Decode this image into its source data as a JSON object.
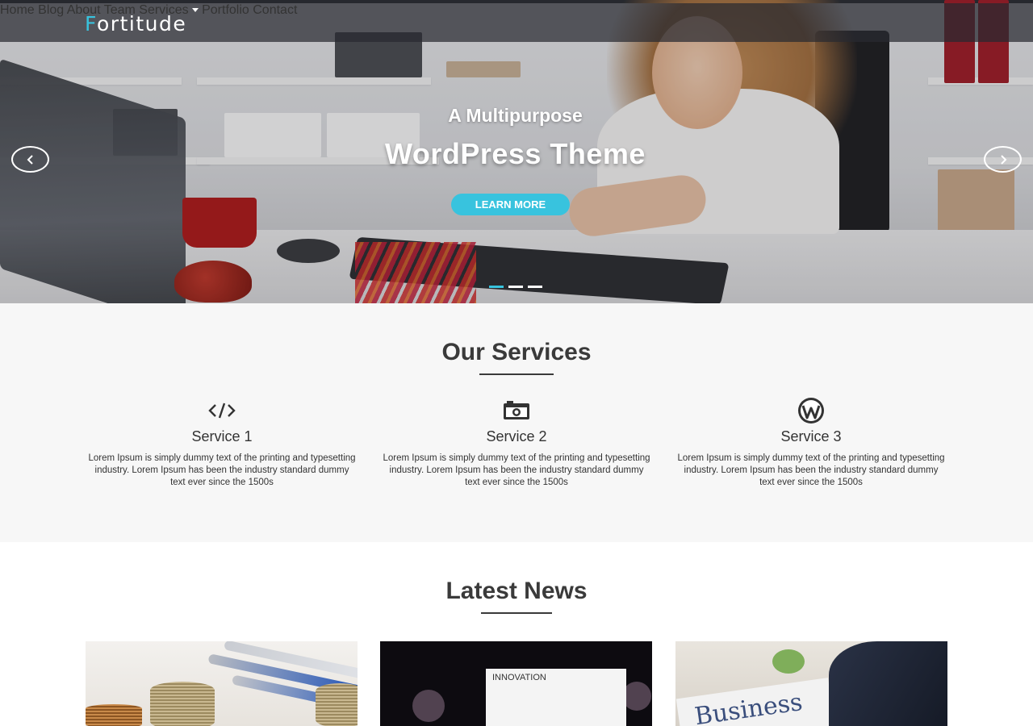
{
  "brand": {
    "logo_first": "F",
    "logo_rest": "ortitude",
    "accent": "#38c3de"
  },
  "nav": {
    "items": [
      {
        "label": "Home",
        "active": true
      },
      {
        "label": "Blog"
      },
      {
        "label": "About"
      },
      {
        "label": "Team"
      },
      {
        "label": "Services",
        "dropdown": true
      },
      {
        "label": "Portfolio"
      },
      {
        "label": "Contact"
      }
    ]
  },
  "hero": {
    "subtitle": "A Multipurpose",
    "title": "WordPress Theme",
    "button_label": "LEARN MORE",
    "prev_icon": "chevron-left-icon",
    "next_icon": "chevron-right-icon",
    "slides": 3,
    "active_slide": 1
  },
  "services": {
    "title": "Our Services",
    "items": [
      {
        "icon": "code-icon",
        "name": "Service 1",
        "desc": "Lorem Ipsum is simply dummy text of the printing and typesetting industry. Lorem Ipsum has been the industry standard dummy text ever since the 1500s"
      },
      {
        "icon": "camera-icon",
        "name": "Service 2",
        "desc": "Lorem Ipsum is simply dummy text of the printing and typesetting industry. Lorem Ipsum has been the industry standard dummy text ever since the 1500s"
      },
      {
        "icon": "wordpress-icon",
        "name": "Service 3",
        "desc": "Lorem Ipsum is simply dummy text of the printing and typesetting industry. Lorem Ipsum has been the industry standard dummy text ever since the 1500s"
      }
    ]
  },
  "news": {
    "title": "Latest News",
    "cards": [
      {
        "image": "coins-and-pens-image"
      },
      {
        "image": "innovation-board-image",
        "board_text": "INNOVATION"
      },
      {
        "image": "business-newspaper-image",
        "paper_text": "Business"
      }
    ]
  }
}
